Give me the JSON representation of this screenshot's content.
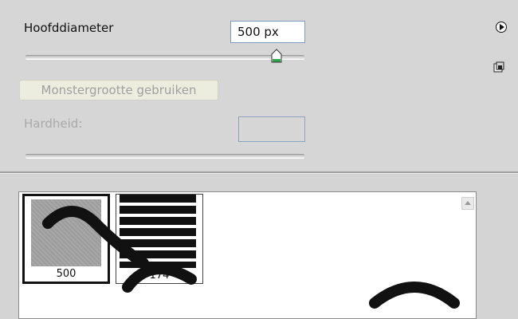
{
  "diameter": {
    "label": "Hoofddiameter",
    "value": "500 px",
    "slider_level_percent": 90
  },
  "sample_button_label": "Monstergrootte gebruiken",
  "hardness": {
    "label": "Hardheid:",
    "value": ""
  },
  "icons": {
    "menu": "play-circle-icon",
    "new_preset": "new-preset-icon"
  },
  "presets": [
    {
      "label": "500",
      "selected": true,
      "style": "soft-gray"
    },
    {
      "label": "174",
      "selected": false,
      "style": "striped"
    }
  ],
  "colors": {
    "panel": "#d6d6d6",
    "field_border": "#7f9db9",
    "disabled_text": "#a0a0a0",
    "slider_thumb": "#2ea84a"
  }
}
